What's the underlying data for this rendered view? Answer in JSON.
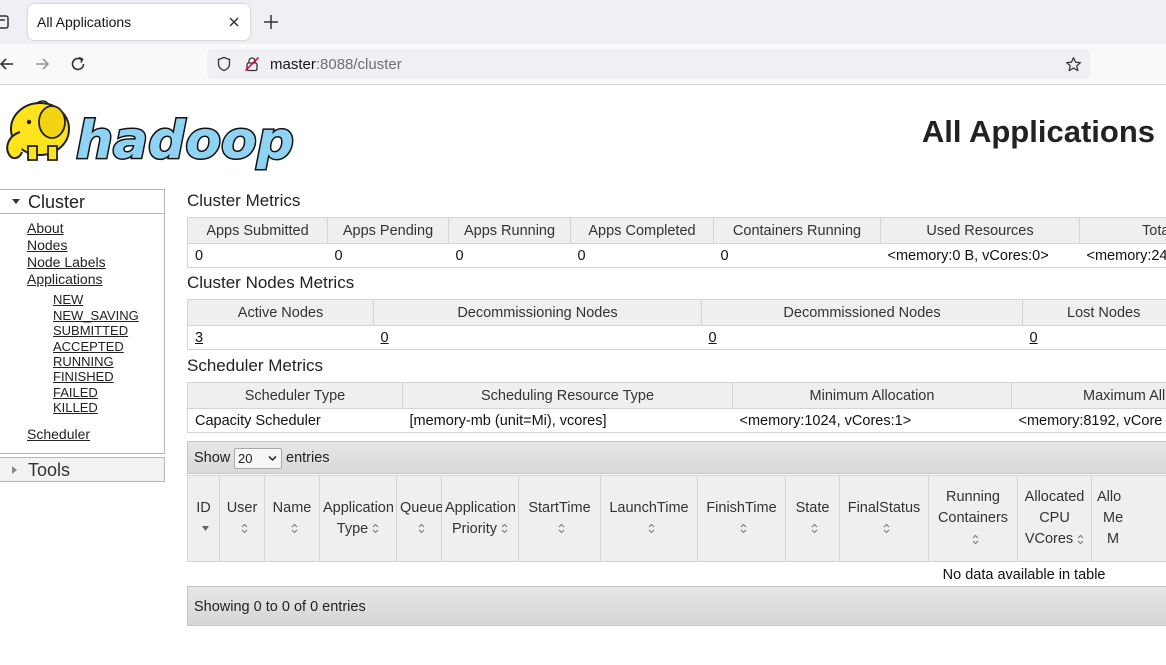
{
  "browser": {
    "tab_title": "All Applications",
    "url_host": "master",
    "url_rest": ":8088/cluster"
  },
  "page": {
    "title": "All Applications",
    "logo_text": "hadoop"
  },
  "sidebar": {
    "cluster_label": "Cluster",
    "tools_label": "Tools",
    "links": [
      "About",
      "Nodes",
      "Node Labels",
      "Applications"
    ],
    "app_states": [
      "NEW",
      "NEW_SAVING",
      "SUBMITTED",
      "ACCEPTED",
      "RUNNING",
      "FINISHED",
      "FAILED",
      "KILLED"
    ],
    "scheduler_label": "Scheduler"
  },
  "cluster_metrics": {
    "title": "Cluster Metrics",
    "headers": [
      "Apps Submitted",
      "Apps Pending",
      "Apps Running",
      "Apps Completed",
      "Containers Running",
      "Used Resources",
      "Total"
    ],
    "values": [
      "0",
      "0",
      "0",
      "0",
      "0",
      "<memory:0 B, vCores:0>",
      "<memory:24"
    ]
  },
  "nodes_metrics": {
    "title": "Cluster Nodes Metrics",
    "headers": [
      "Active Nodes",
      "Decommissioning Nodes",
      "Decommissioned Nodes",
      "Lost Nodes"
    ],
    "values": [
      "3",
      "0",
      "0",
      "0"
    ]
  },
  "scheduler_metrics": {
    "title": "Scheduler Metrics",
    "headers": [
      "Scheduler Type",
      "Scheduling Resource Type",
      "Minimum Allocation",
      "Maximum All"
    ],
    "values": [
      "Capacity Scheduler",
      "[memory-mb (unit=Mi), vcores]",
      "<memory:1024, vCores:1>",
      "<memory:8192, vCore"
    ]
  },
  "apps_table": {
    "show_label": "Show",
    "entries_label": "entries",
    "page_size": "20",
    "headers": [
      [
        "ID"
      ],
      [
        "User"
      ],
      [
        "Name"
      ],
      [
        "Application",
        "Type"
      ],
      [
        "Queue"
      ],
      [
        "Application",
        "Priority"
      ],
      [
        "StartTime"
      ],
      [
        "LaunchTime"
      ],
      [
        "FinishTime"
      ],
      [
        "State"
      ],
      [
        "FinalStatus"
      ],
      [
        "Running",
        "Containers"
      ],
      [
        "Allocated",
        "CPU",
        "VCores"
      ],
      [
        "Allo",
        "Me",
        "M"
      ]
    ],
    "empty_text": "No data available in table",
    "info_text": "Showing 0 to 0 of 0 entries"
  }
}
